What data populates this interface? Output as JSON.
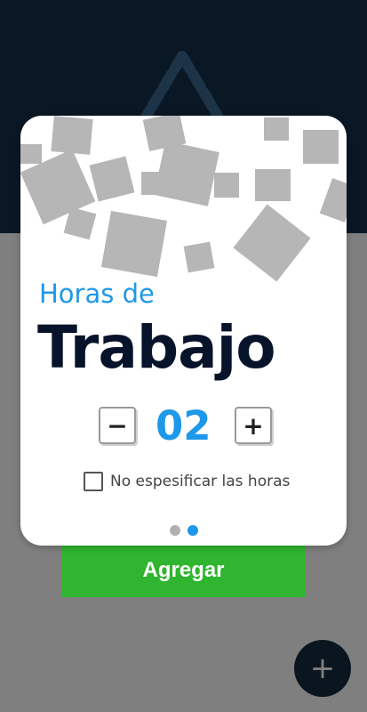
{
  "dialog": {
    "title_line1": "Horas de",
    "title_line2": "Trabajo",
    "hours_value": "02",
    "decrement_symbol": "−",
    "increment_symbol": "+",
    "checkbox_label": "No espesificar las horas",
    "checkbox_checked": false,
    "page_indicator": {
      "count": 2,
      "active_index": 1
    }
  },
  "buttons": {
    "add_label": "Agregar",
    "fab_symbol": "+"
  },
  "colors": {
    "accent": "#1e98e8",
    "title_dark": "#06132a",
    "add_button": "#2fb52f",
    "header_bg": "#0a1724",
    "dot_inactive": "#b0b0b0",
    "dot_active": "#1e98e8"
  },
  "icons": {
    "logo": "triangle-logo-icon",
    "fab": "plus-icon"
  }
}
